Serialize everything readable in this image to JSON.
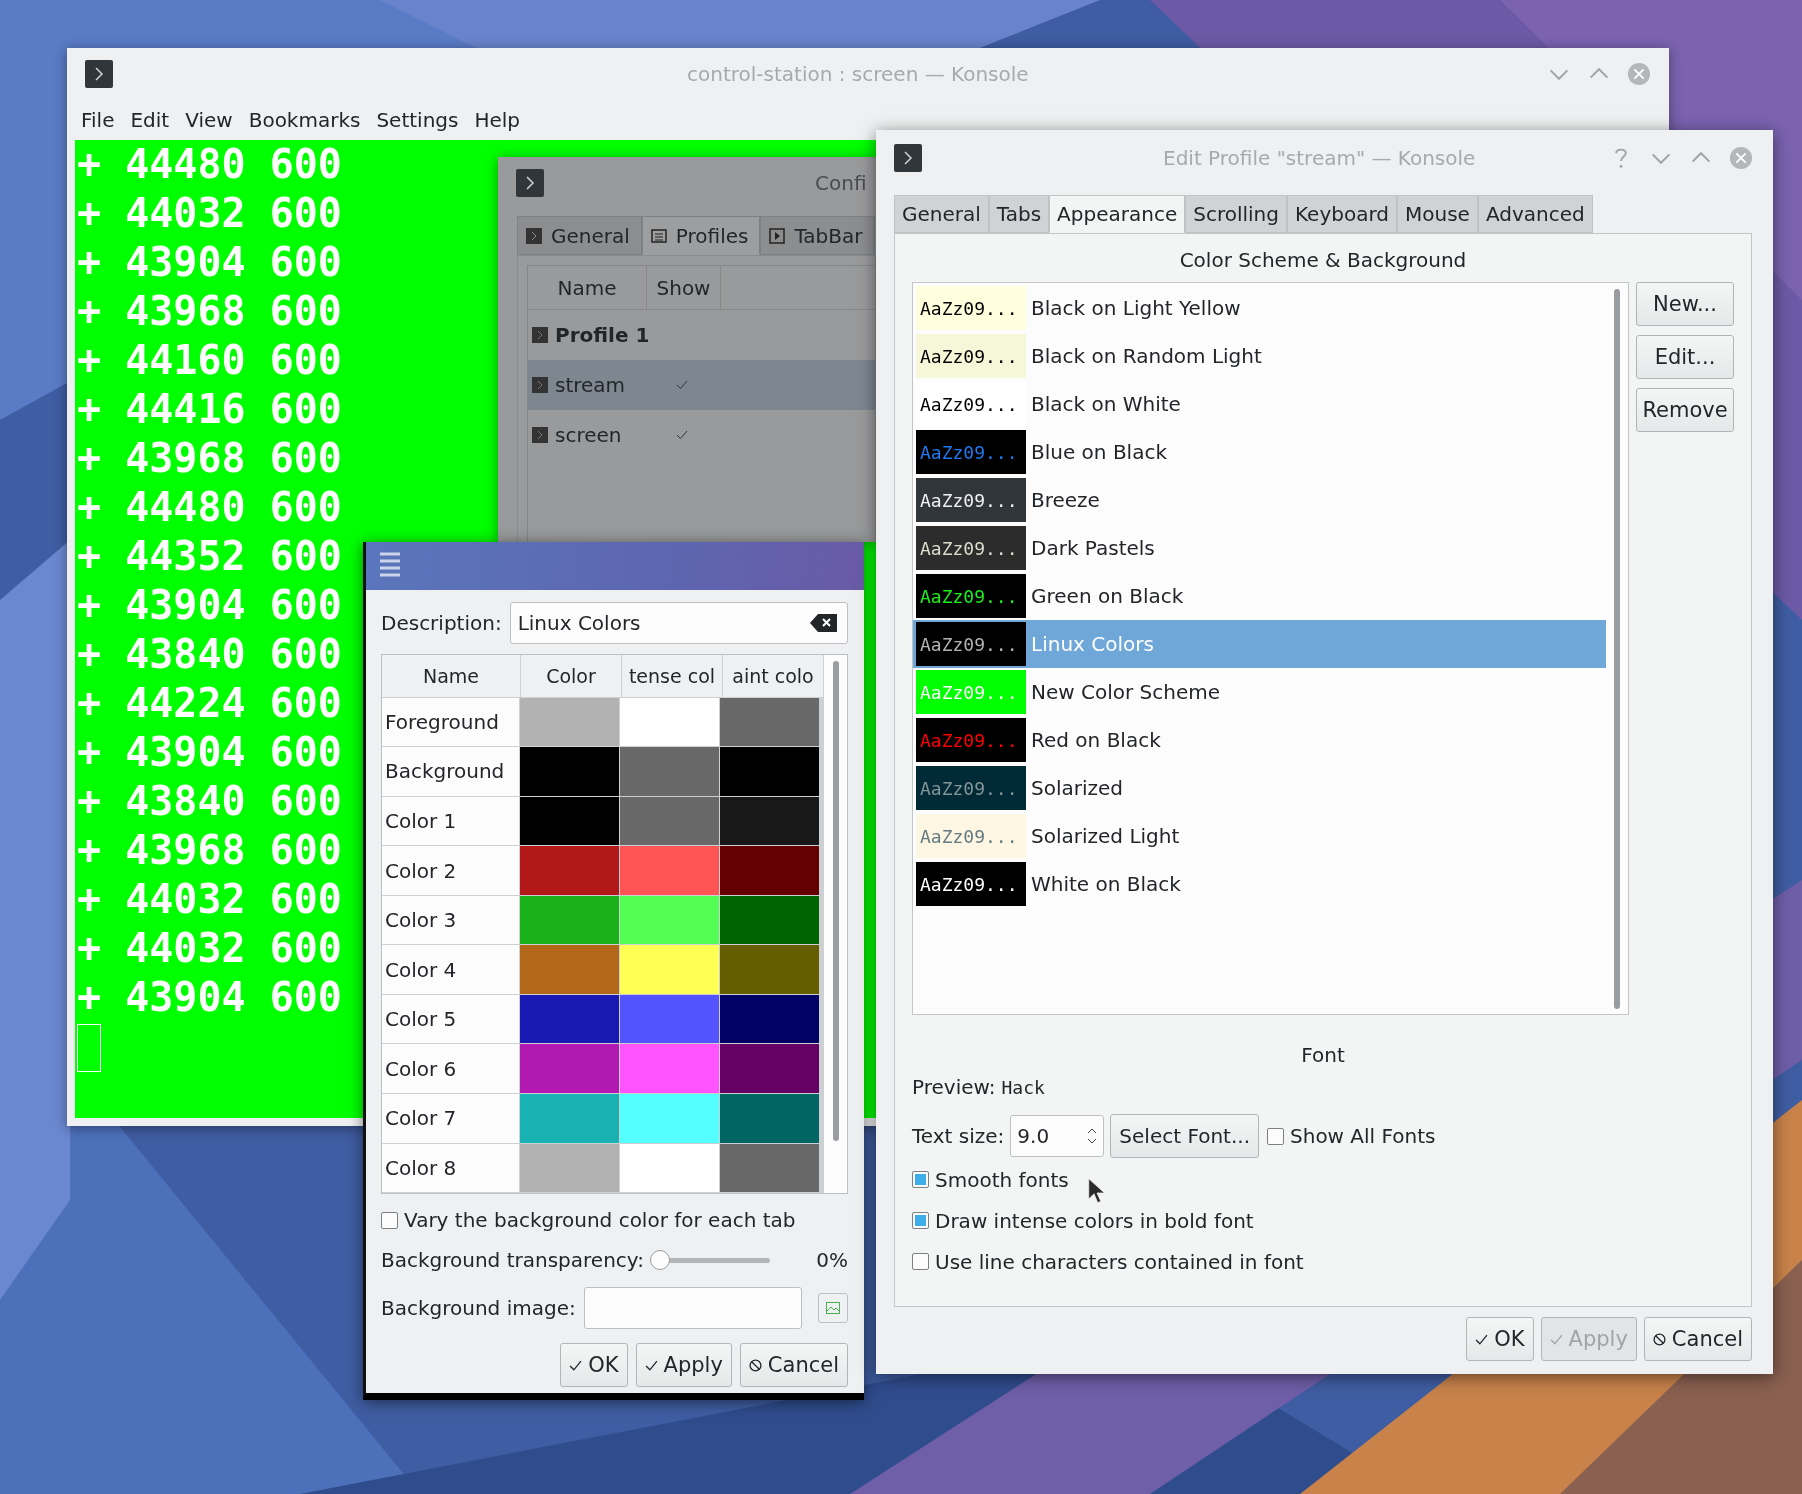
{
  "konsole": {
    "title": "control-station : screen — Konsole",
    "menu": [
      "File",
      "Edit",
      "View",
      "Bookmarks",
      "Settings",
      "Help"
    ],
    "terminal_lines": [
      "+ 44480 600",
      "+ 44032 600",
      "+ 43904 600",
      "+ 43968 600",
      "+ 44160 600",
      "+ 44416 600",
      "+ 43968 600",
      "+ 44480 600",
      "+ 44352 600",
      "+ 43904 600",
      "+ 43840 600",
      "+ 44224 600",
      "+ 43904 600",
      "+ 43840 600",
      "+ 43968 600",
      "+ 44032 600",
      "+ 44032 600",
      "+ 43904 600"
    ]
  },
  "config_dialog": {
    "title": "Confi",
    "tabs": [
      {
        "label": "General",
        "selected": false
      },
      {
        "label": "Profiles",
        "selected": true
      },
      {
        "label": "TabBar",
        "selected": false
      }
    ],
    "columns": [
      "Name",
      "Show"
    ],
    "profiles": [
      {
        "name": "Profile 1",
        "default": true,
        "show": false,
        "selected": false
      },
      {
        "name": "stream",
        "default": false,
        "show": true,
        "selected": true
      },
      {
        "name": "screen",
        "default": false,
        "show": true,
        "selected": false
      }
    ]
  },
  "color_dialog": {
    "description_label": "Description:",
    "description": "Linux Colors",
    "columns": [
      "Name",
      "Color",
      "tense col",
      "aint colo"
    ],
    "rows": [
      {
        "name": "Foreground",
        "swatches": [
          {
            "color": "#b2b2b2"
          },
          {
            "color": "#ffffff"
          },
          {
            "color": "#686868"
          }
        ]
      },
      {
        "name": "Background",
        "swatches": [
          {
            "color": "#000000"
          },
          {
            "color": "#686868"
          },
          {
            "color": "#000000"
          }
        ]
      },
      {
        "name": "Color 1",
        "swatches": [
          {
            "color": "#000000"
          },
          {
            "color": "#686868"
          },
          {
            "color": "#181818"
          }
        ]
      },
      {
        "name": "Color 2",
        "swatches": [
          {
            "color": "#b21818"
          },
          {
            "color": "#ff5454"
          },
          {
            "color": "#650000"
          }
        ]
      },
      {
        "name": "Color 3",
        "swatches": [
          {
            "color": "#18b218"
          },
          {
            "color": "#54ff54"
          },
          {
            "color": "#006500"
          }
        ]
      },
      {
        "name": "Color 4",
        "swatches": [
          {
            "color": "#b26818"
          },
          {
            "color": "#ffff54"
          },
          {
            "color": "#655e00"
          }
        ]
      },
      {
        "name": "Color 5",
        "swatches": [
          {
            "color": "#1818b2"
          },
          {
            "color": "#5454ff"
          },
          {
            "color": "#000065"
          }
        ]
      },
      {
        "name": "Color 6",
        "swatches": [
          {
            "color": "#b218b2"
          },
          {
            "color": "#ff54ff"
          },
          {
            "color": "#650065"
          }
        ]
      },
      {
        "name": "Color 7",
        "swatches": [
          {
            "color": "#18b2b2"
          },
          {
            "color": "#54ffff"
          },
          {
            "color": "#006565"
          }
        ]
      },
      {
        "name": "Color 8",
        "swatches": [
          {
            "color": "#b2b2b2"
          },
          {
            "color": "#ffffff"
          },
          {
            "color": "#686868"
          }
        ]
      }
    ],
    "vary_tab_color": {
      "label": "Vary the background color for each tab",
      "checked": false
    },
    "transparency": {
      "label": "Background transparency:",
      "level": 0,
      "reading": "0%"
    },
    "image_label": "Background image:",
    "buttons": [
      {
        "label": "OK",
        "kind": "accept",
        "disabled": false
      },
      {
        "label": "Apply",
        "kind": "accept",
        "disabled": false
      },
      {
        "label": "Cancel",
        "kind": "reject",
        "disabled": false
      }
    ]
  },
  "edit_profile": {
    "title": "Edit Profile \"stream\" — Konsole",
    "tabs": [
      {
        "label": "General",
        "selected": false
      },
      {
        "label": "Tabs",
        "selected": false
      },
      {
        "label": "Appearance",
        "selected": true
      },
      {
        "label": "Scrolling",
        "selected": false
      },
      {
        "label": "Keyboard",
        "selected": false
      },
      {
        "label": "Mouse",
        "selected": false
      },
      {
        "label": "Advanced",
        "selected": false
      }
    ],
    "scheme_heading": "Color Scheme & Background",
    "schemes": [
      {
        "name": "Black on Light Yellow",
        "selected": false,
        "background": {
          "color": "#ffffdd"
        },
        "sample": {
          "text": "AaZz09...",
          "color": "#000000"
        }
      },
      {
        "name": "Black on Random Light",
        "selected": false,
        "background": {
          "color": "#f6f6d8"
        },
        "sample": {
          "text": "AaZz09...",
          "color": "#000000"
        }
      },
      {
        "name": "Black on White",
        "selected": false,
        "background": {
          "color": "#ffffff"
        },
        "sample": {
          "text": "AaZz09...",
          "color": "#000000"
        }
      },
      {
        "name": "Blue on Black",
        "selected": false,
        "background": {
          "color": "#000000"
        },
        "sample": {
          "text": "AaZz09...",
          "color": "#1e78f0"
        }
      },
      {
        "name": "Breeze",
        "selected": false,
        "background": {
          "color": "#31363b"
        },
        "sample": {
          "text": "AaZz09...",
          "color": "#eff0f1"
        }
      },
      {
        "name": "Dark Pastels",
        "selected": false,
        "background": {
          "color": "#2c2c2c"
        },
        "sample": {
          "text": "AaZz09...",
          "color": "#dcdccc"
        }
      },
      {
        "name": "Green on Black",
        "selected": false,
        "background": {
          "color": "#000000"
        },
        "sample": {
          "text": "AaZz09...",
          "color": "#18f018"
        }
      },
      {
        "name": "Linux Colors",
        "selected": true,
        "background": {
          "color": "#000000"
        },
        "sample": {
          "text": "AaZz09...",
          "color": "#b2b2b2"
        }
      },
      {
        "name": "New Color Scheme",
        "selected": false,
        "background": {
          "color": "#00ff00"
        },
        "sample": {
          "text": "AaZz09...",
          "color": "#ffffff"
        }
      },
      {
        "name": "Red on Black",
        "selected": false,
        "background": {
          "color": "#000000"
        },
        "sample": {
          "text": "AaZz09...",
          "color": "#ff0000"
        }
      },
      {
        "name": "Solarized",
        "selected": false,
        "background": {
          "color": "#002b36"
        },
        "sample": {
          "text": "AaZz09...",
          "color": "#839496"
        }
      },
      {
        "name": "Solarized Light",
        "selected": false,
        "background": {
          "color": "#fdf6e3"
        },
        "sample": {
          "text": "AaZz09...",
          "color": "#657b83"
        }
      },
      {
        "name": "White on Black",
        "selected": false,
        "background": {
          "color": "#000000"
        },
        "sample": {
          "text": "AaZz09...",
          "color": "#ffffff"
        }
      }
    ],
    "scheme_buttons": [
      "New...",
      "Edit...",
      "Remove"
    ],
    "font_heading": "Font",
    "preview_label": "Preview:",
    "preview_font": "Hack",
    "text_size_label": "Text size:",
    "text_size": "9.0",
    "select_font": "Select Font...",
    "show_all_fonts": {
      "label": "Show All Fonts",
      "checked": false
    },
    "options": [
      {
        "label": "Smooth fonts",
        "checked": true
      },
      {
        "label": "Draw intense colors in bold font",
        "checked": true
      },
      {
        "label": "Use line characters contained in font",
        "checked": false
      }
    ],
    "buttons": [
      {
        "label": "OK",
        "kind": "accept",
        "disabled": false
      },
      {
        "label": "Apply",
        "kind": "accept",
        "disabled": true
      },
      {
        "label": "Cancel",
        "kind": "reject",
        "disabled": false
      }
    ]
  }
}
